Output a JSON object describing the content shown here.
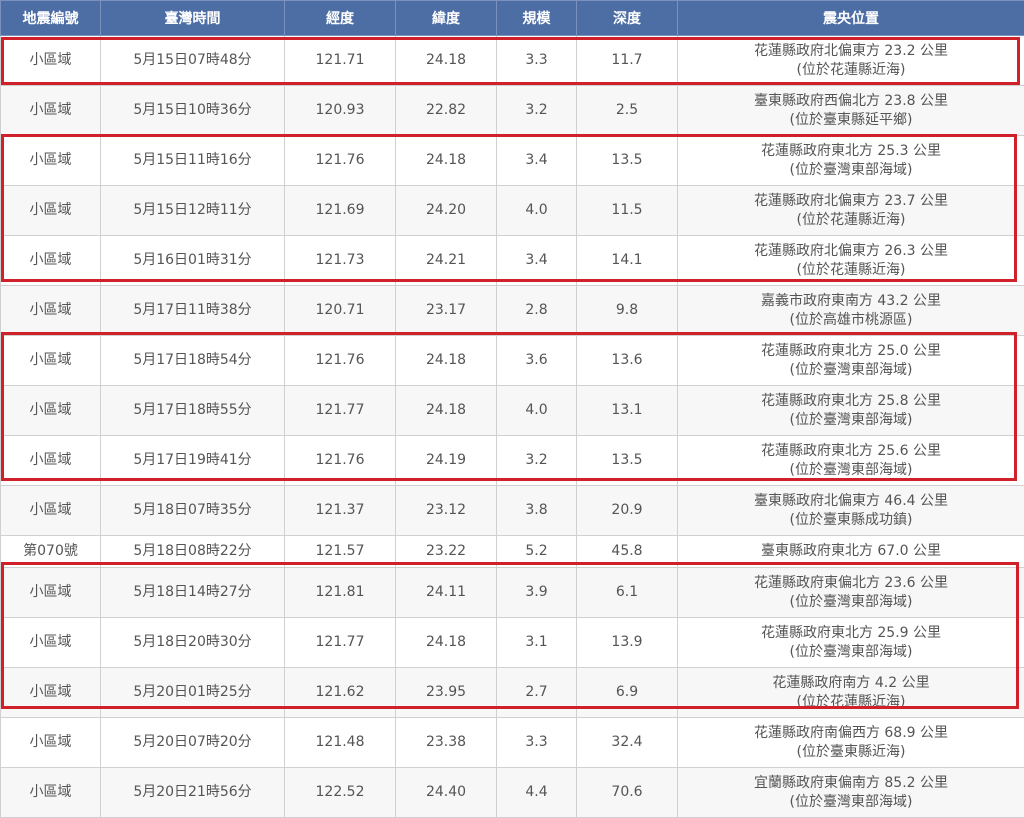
{
  "headers": [
    "地震編號",
    "臺灣時間",
    "經度",
    "緯度",
    "規模",
    "深度",
    "震央位置"
  ],
  "rows": [
    {
      "id": "小區域",
      "time": "5月15日07時48分",
      "lon": "121.71",
      "lat": "24.18",
      "mag": "3.3",
      "depth": "11.7",
      "loc1": "花蓮縣政府北偏東方 23.2 公里",
      "loc2": "(位於花蓮縣近海)"
    },
    {
      "id": "小區域",
      "time": "5月15日10時36分",
      "lon": "120.93",
      "lat": "22.82",
      "mag": "3.2",
      "depth": "2.5",
      "loc1": "臺東縣政府西偏北方 23.8 公里",
      "loc2": "(位於臺東縣延平鄉)"
    },
    {
      "id": "小區域",
      "time": "5月15日11時16分",
      "lon": "121.76",
      "lat": "24.18",
      "mag": "3.4",
      "depth": "13.5",
      "loc1": "花蓮縣政府東北方 25.3 公里",
      "loc2": "(位於臺灣東部海域)"
    },
    {
      "id": "小區域",
      "time": "5月15日12時11分",
      "lon": "121.69",
      "lat": "24.20",
      "mag": "4.0",
      "depth": "11.5",
      "loc1": "花蓮縣政府北偏東方 23.7 公里",
      "loc2": "(位於花蓮縣近海)"
    },
    {
      "id": "小區域",
      "time": "5月16日01時31分",
      "lon": "121.73",
      "lat": "24.21",
      "mag": "3.4",
      "depth": "14.1",
      "loc1": "花蓮縣政府北偏東方 26.3 公里",
      "loc2": "(位於花蓮縣近海)"
    },
    {
      "id": "小區域",
      "time": "5月17日11時38分",
      "lon": "120.71",
      "lat": "23.17",
      "mag": "2.8",
      "depth": "9.8",
      "loc1": "嘉義市政府東南方 43.2 公里",
      "loc2": "(位於高雄市桃源區)"
    },
    {
      "id": "小區域",
      "time": "5月17日18時54分",
      "lon": "121.76",
      "lat": "24.18",
      "mag": "3.6",
      "depth": "13.6",
      "loc1": "花蓮縣政府東北方 25.0 公里",
      "loc2": "(位於臺灣東部海域)"
    },
    {
      "id": "小區域",
      "time": "5月17日18時55分",
      "lon": "121.77",
      "lat": "24.18",
      "mag": "4.0",
      "depth": "13.1",
      "loc1": "花蓮縣政府東北方 25.8 公里",
      "loc2": "(位於臺灣東部海域)"
    },
    {
      "id": "小區域",
      "time": "5月17日19時41分",
      "lon": "121.76",
      "lat": "24.19",
      "mag": "3.2",
      "depth": "13.5",
      "loc1": "花蓮縣政府東北方 25.6 公里",
      "loc2": "(位於臺灣東部海域)"
    },
    {
      "id": "小區域",
      "time": "5月18日07時35分",
      "lon": "121.37",
      "lat": "23.12",
      "mag": "3.8",
      "depth": "20.9",
      "loc1": "臺東縣政府北偏東方 46.4 公里",
      "loc2": "(位於臺東縣成功鎮)"
    },
    {
      "id": "第070號",
      "time": "5月18日08時22分",
      "lon": "121.57",
      "lat": "23.22",
      "mag": "5.2",
      "depth": "45.8",
      "loc1": "臺東縣政府東北方 67.0 公里",
      "loc2": ""
    },
    {
      "id": "小區域",
      "time": "5月18日14時27分",
      "lon": "121.81",
      "lat": "24.11",
      "mag": "3.9",
      "depth": "6.1",
      "loc1": "花蓮縣政府東偏北方 23.6 公里",
      "loc2": "(位於臺灣東部海域)"
    },
    {
      "id": "小區域",
      "time": "5月18日20時30分",
      "lon": "121.77",
      "lat": "24.18",
      "mag": "3.1",
      "depth": "13.9",
      "loc1": "花蓮縣政府東北方 25.9 公里",
      "loc2": "(位於臺灣東部海域)"
    },
    {
      "id": "小區域",
      "time": "5月20日01時25分",
      "lon": "121.62",
      "lat": "23.95",
      "mag": "2.7",
      "depth": "6.9",
      "loc1": "花蓮縣政府南方 4.2 公里",
      "loc2": "(位於花蓮縣近海)"
    },
    {
      "id": "小區域",
      "time": "5月20日07時20分",
      "lon": "121.48",
      "lat": "23.38",
      "mag": "3.3",
      "depth": "32.4",
      "loc1": "花蓮縣政府南偏西方 68.9 公里",
      "loc2": "(位於臺東縣近海)"
    },
    {
      "id": "小區域",
      "time": "5月20日21時56分",
      "lon": "122.52",
      "lat": "24.40",
      "mag": "4.4",
      "depth": "70.6",
      "loc1": "宜蘭縣政府東偏南方 85.2 公里",
      "loc2": "(位於臺灣東部海域)"
    }
  ],
  "highlight_color": "#d0202a",
  "header_color": "#4c6ea4"
}
